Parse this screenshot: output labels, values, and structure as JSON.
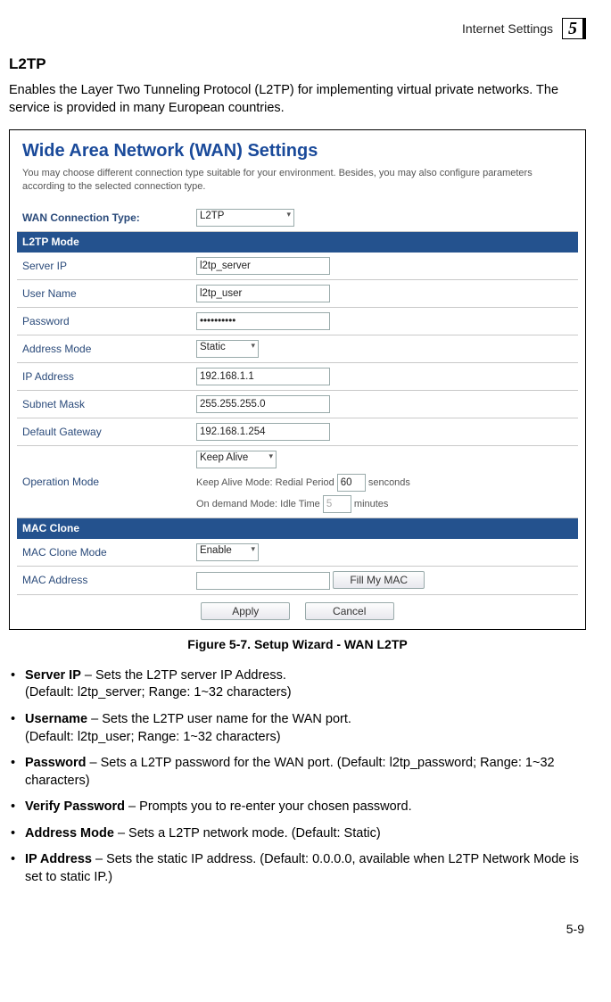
{
  "header": {
    "title": "Internet Settings",
    "chapter": "5"
  },
  "section": {
    "heading": "L2TP",
    "intro": "Enables the Layer Two Tunneling Protocol (L2TP) for implementing virtual private networks. The service is provided in many European countries."
  },
  "panel": {
    "title": "Wide Area Network (WAN) Settings",
    "subtitle": "You may choose different connection type suitable for your environment. Besides, you may also configure parameters according to the selected connection type."
  },
  "form": {
    "wan_label": "WAN Connection Type:",
    "wan_value": "L2TP",
    "group_l2tp": "L2TP Mode",
    "server_ip_label": "Server IP",
    "server_ip_value": "l2tp_server",
    "user_label": "User Name",
    "user_value": "l2tp_user",
    "pass_label": "Password",
    "pass_value": "••••••••••",
    "addr_mode_label": "Address Mode",
    "addr_mode_value": "Static",
    "ip_label": "IP Address",
    "ip_value": "192.168.1.1",
    "mask_label": "Subnet Mask",
    "mask_value": "255.255.255.0",
    "gw_label": "Default Gateway",
    "gw_value": "192.168.1.254",
    "op_label": "Operation Mode",
    "op_value": "Keep Alive",
    "op_redial_text_a": "Keep Alive Mode: Redial Period",
    "op_redial_value": "60",
    "op_redial_text_b": "senconds",
    "op_demand_text_a": "On demand Mode: Idle Time",
    "op_demand_value": "5",
    "op_demand_text_b": "minutes",
    "group_mac": "MAC Clone",
    "mac_mode_label": "MAC Clone Mode",
    "mac_mode_value": "Enable",
    "mac_addr_label": "MAC Address",
    "mac_addr_value": "",
    "fill_mac_btn": "Fill My MAC",
    "apply_btn": "Apply",
    "cancel_btn": "Cancel"
  },
  "caption": "Figure 5-7.   Setup Wizard - WAN L2TP",
  "bullets": {
    "b1a": "Server IP",
    "b1b": " – Sets the L2TP server IP Address.",
    "b1c": "(Default: l2tp_server; Range: 1~32 characters)",
    "b2a": "Username",
    "b2b": " – Sets the L2TP user name for the WAN port.",
    "b2c": "(Default: l2tp_user; Range: 1~32 characters)",
    "b3a": "Password",
    "b3b": " – Sets a L2TP password for the WAN port. (Default: l2tp_password; Range: 1~32 characters)",
    "b4a": "Verify Password",
    "b4b": " – Prompts you to re-enter your chosen password.",
    "b5a": "Address Mode",
    "b5b": " – Sets a L2TP network mode. (Default: Static)",
    "b6a": "IP Address",
    "b6b": " – Sets the static IP address. (Default: 0.0.0.0, available when L2TP Network Mode is set to static IP.)"
  },
  "page_number": "5-9"
}
